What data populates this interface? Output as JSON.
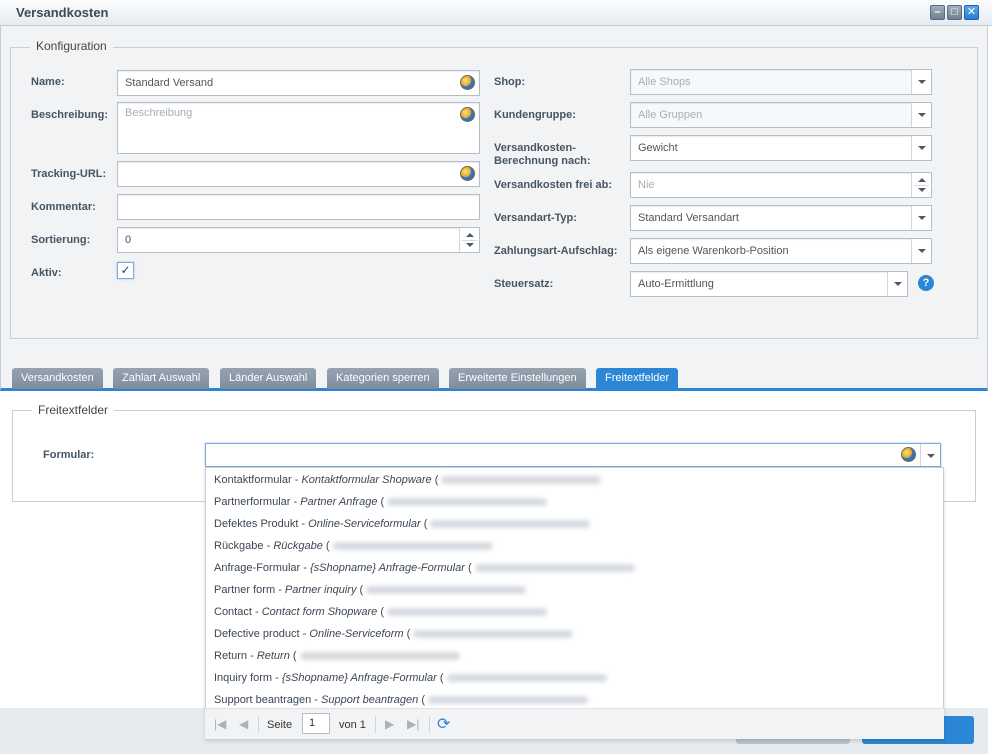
{
  "window": {
    "title": "Versandkosten"
  },
  "config": {
    "legend": "Konfiguration",
    "name": {
      "label": "Name:",
      "value": "Standard Versand"
    },
    "beschreibung": {
      "label": "Beschreibung:",
      "placeholder": "Beschreibung"
    },
    "tracking": {
      "label": "Tracking-URL:",
      "value": ""
    },
    "kommentar": {
      "label": "Kommentar:",
      "value": ""
    },
    "sortierung": {
      "label": "Sortierung:",
      "value": "0"
    },
    "aktiv": {
      "label": "Aktiv:",
      "checked": true
    },
    "shop": {
      "label": "Shop:",
      "value": "Alle Shops"
    },
    "kundengruppe": {
      "label": "Kundengruppe:",
      "value": "Alle Gruppen"
    },
    "berechnung": {
      "label": "Versandkosten-Berechnung nach:",
      "value": "Gewicht"
    },
    "frei_ab": {
      "label": "Versandkosten frei ab:",
      "placeholder": "Nie"
    },
    "versandart": {
      "label": "Versandart-Typ:",
      "value": "Standard Versandart"
    },
    "zahlungsart": {
      "label": "Zahlungsart-Aufschlag:",
      "value": "Als eigene Warenkorb-Position"
    },
    "steuersatz": {
      "label": "Steuersatz:",
      "value": "Auto-Ermittlung"
    }
  },
  "tabs": [
    {
      "label": "Versandkosten",
      "active": false
    },
    {
      "label": "Zahlart Auswahl",
      "active": false
    },
    {
      "label": "Länder Auswahl",
      "active": false
    },
    {
      "label": "Kategorien sperren",
      "active": false
    },
    {
      "label": "Erweiterte Einstellungen",
      "active": false
    },
    {
      "label": "Freitextfelder",
      "active": true
    }
  ],
  "freitext": {
    "legend": "Freitextfelder",
    "formular_label": "Formular:",
    "formular_value": ""
  },
  "dropdown_items": [
    {
      "name": "Kontaktformular",
      "title": "Kontaktformular Shopware"
    },
    {
      "name": "Partnerformular",
      "title": "Partner Anfrage"
    },
    {
      "name": "Defektes Produkt",
      "title": "Online-Serviceformular"
    },
    {
      "name": "Rückgabe",
      "title": "Rückgabe"
    },
    {
      "name": "Anfrage-Formular",
      "title": "{sShopname} Anfrage-Formular"
    },
    {
      "name": "Partner form",
      "title": "Partner inquiry"
    },
    {
      "name": "Contact",
      "title": "Contact form Shopware"
    },
    {
      "name": "Defective product",
      "title": "Online-Serviceform"
    },
    {
      "name": "Return",
      "title": "Return"
    },
    {
      "name": "Inquiry form",
      "title": "{sShopname} Anfrage-Formular"
    },
    {
      "name": "Support beantragen",
      "title": "Support beantragen"
    }
  ],
  "pager": {
    "page_label": "Seite",
    "page": "1",
    "of_label": "von 1"
  }
}
